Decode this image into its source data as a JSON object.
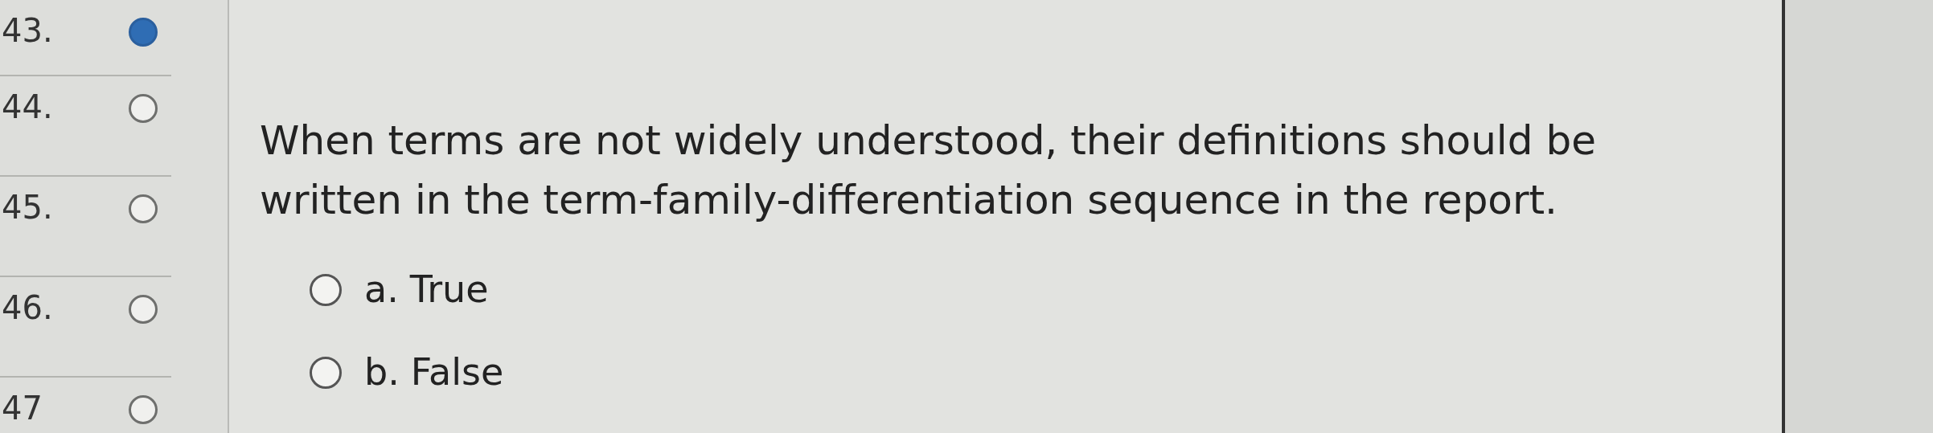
{
  "question_nav": [
    {
      "number": "43.",
      "answered": true
    },
    {
      "number": "44.",
      "answered": false
    },
    {
      "number": "45.",
      "answered": false
    },
    {
      "number": "46.",
      "answered": false
    },
    {
      "number": "47",
      "answered": false
    }
  ],
  "question": {
    "text": "When terms are not widely understood, their definitions should be written in the term-family-differentiation sequence in the report.",
    "options": [
      {
        "letter": "a.",
        "label": "True",
        "selected": false
      },
      {
        "letter": "b.",
        "label": "False",
        "selected": false
      }
    ]
  }
}
